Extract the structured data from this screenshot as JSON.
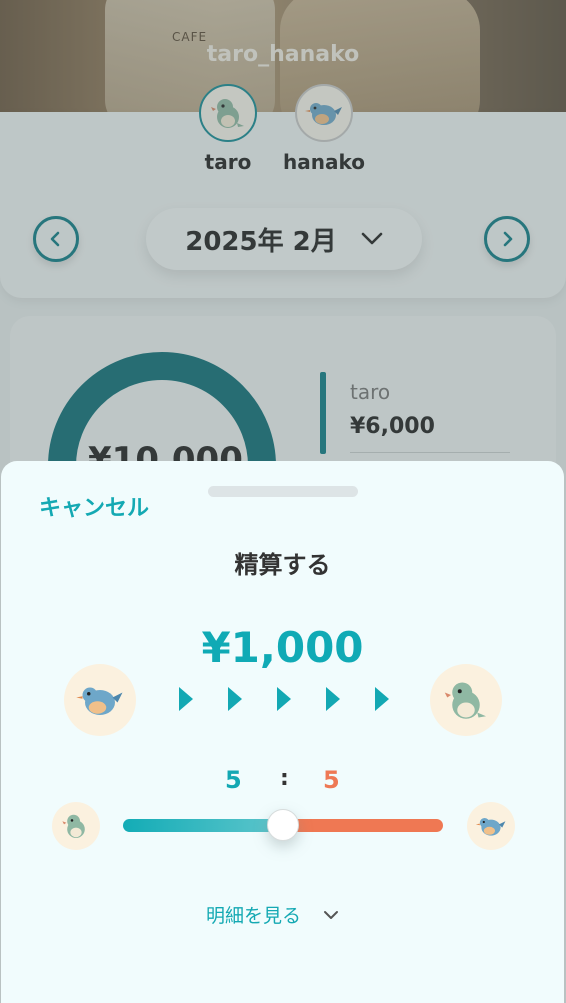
{
  "group": {
    "name": "taro_hanako",
    "cover_text": "CAFE"
  },
  "members": [
    {
      "name": "taro",
      "avatar_icon": "dinosaur-icon"
    },
    {
      "name": "hanako",
      "avatar_icon": "bird-icon"
    }
  ],
  "month_selector": {
    "label": "2025年 2月",
    "prev_icon": "chevron-left-icon",
    "next_icon": "chevron-right-icon",
    "dropdown_icon": "chevron-down-icon"
  },
  "summary": {
    "total": "¥10,000",
    "breakdown": [
      {
        "name": "taro",
        "amount": "¥6,000"
      }
    ]
  },
  "settle_sheet": {
    "cancel_label": "キャンセル",
    "title": "精算する",
    "amount": "¥1,000",
    "from_member": "hanako",
    "to_member": "taro",
    "ratio_left": "5",
    "ratio_sep": ":",
    "ratio_right": "5",
    "slider_value": 0.5,
    "details_label": "明細を見る"
  },
  "colors": {
    "accent": "#13a8b3",
    "secondary": "#ef7853",
    "dark_teal": "#0f7d86",
    "sheet_bg": "#f1fcfd"
  }
}
